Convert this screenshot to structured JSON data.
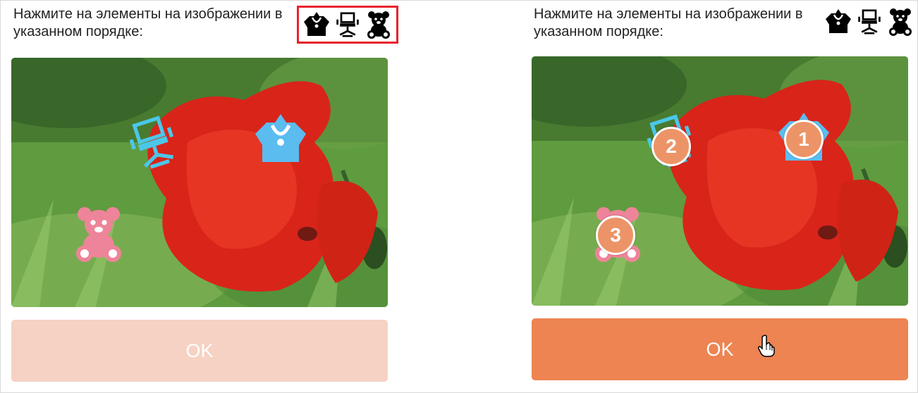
{
  "left_panel": {
    "instruction": "Нажмите на элементы на изображении в указанном порядке:",
    "target_icons": [
      "jewelry-bust-icon",
      "office-chair-icon",
      "teddy-bear-icon"
    ],
    "ok_label": "OK",
    "state": "disabled"
  },
  "right_panel": {
    "instruction": "Нажмите на элементы на изображении в указанном порядке:",
    "target_icons": [
      "jewelry-bust-icon",
      "office-chair-icon",
      "teddy-bear-icon"
    ],
    "markers": [
      "1",
      "2",
      "3"
    ],
    "ok_label": "OK",
    "state": "active"
  },
  "colors": {
    "highlight_border": "#e8242c",
    "ok_disabled": "#f5d2c3",
    "ok_active": "#ed8452",
    "marker": "#ec9467",
    "bust_icon": "#5bbcf0",
    "chair_icon": "#4bc7e8",
    "bear_icon": "#ee8499"
  }
}
